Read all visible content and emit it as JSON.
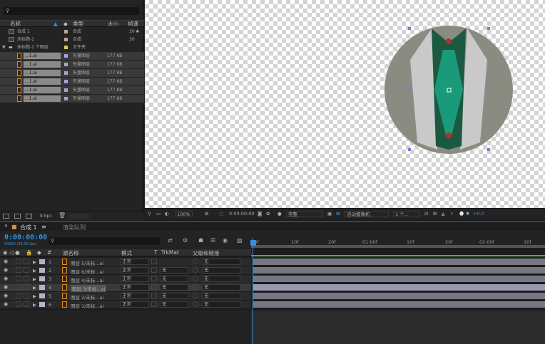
{
  "project": {
    "search_icon": "search-icon",
    "columns": {
      "name": "名称",
      "type": "类型",
      "size": "大小",
      "frame_rate": "帧速"
    },
    "items": [
      {
        "name": "合成 1",
        "type": "合成",
        "size": "",
        "fps": "30"
      },
      {
        "name": "未标题-1",
        "type": "合成",
        "size": "",
        "fps": "30"
      },
      {
        "name": "未标题-1 个图层",
        "type": "文件夹",
        "size": "",
        "fps": ""
      },
      {
        "name": "...1.ai",
        "type": "矢量图层",
        "size": "177 KB",
        "fps": ""
      },
      {
        "name": "...1.ai",
        "type": "矢量图层",
        "size": "177 KB",
        "fps": ""
      },
      {
        "name": "...1.ai",
        "type": "矢量图层",
        "size": "177 KB",
        "fps": ""
      },
      {
        "name": "...1.ai",
        "type": "矢量图层",
        "size": "177 KB",
        "fps": ""
      },
      {
        "name": "...1.ai",
        "type": "矢量图层",
        "size": "177 KB",
        "fps": ""
      },
      {
        "name": "...1.ai",
        "type": "矢量图层",
        "size": "177 KB",
        "fps": ""
      }
    ],
    "bpc": "8 bpc"
  },
  "viewer_toolbar": {
    "zoom": "100%",
    "timecode": "0:00:00:00",
    "resolution": "完整",
    "camera": "活动摄像机",
    "views": "1 个...",
    "exposure": "+0.0"
  },
  "timeline": {
    "tabs": [
      "合成 1",
      "渲染队列"
    ],
    "current_time": "0:00:00:00",
    "current_time_sub": "00000 (30.00 fps)",
    "ruler": [
      "0f",
      "10f",
      "20f",
      "01:00f",
      "10f",
      "20f",
      "02:00f",
      "10f"
    ],
    "columns": {
      "num": "#",
      "source": "源名称",
      "mode": "模式",
      "t": "T",
      "trkmat": "TrkMat",
      "parent": "父级和链接"
    },
    "layers": [
      {
        "num": "1",
        "name": "图层 5/未标...ai",
        "mode": "正常",
        "trkmat": "",
        "parent": "无"
      },
      {
        "num": "2",
        "name": "图层 6/未标...ai",
        "mode": "正常",
        "trkmat": "无",
        "parent": "无"
      },
      {
        "num": "3",
        "name": "图层 4/未标...ai",
        "mode": "正常",
        "trkmat": "无",
        "parent": "无"
      },
      {
        "num": "4",
        "name": "图层 3/未标...ai",
        "mode": "正常",
        "trkmat": "无",
        "parent": "无"
      },
      {
        "num": "5",
        "name": "图层 2/未标...ai",
        "mode": "正常",
        "trkmat": "无",
        "parent": "无"
      },
      {
        "num": "6",
        "name": "图层 1/未标...ai",
        "mode": "正常",
        "trkmat": "无",
        "parent": "无"
      }
    ]
  },
  "colors": {
    "accent": "#3b8fd9",
    "graphic_bg": "#8a8c82",
    "graphic_green": "#1b5a40",
    "graphic_teal": "#1a9a7a"
  }
}
